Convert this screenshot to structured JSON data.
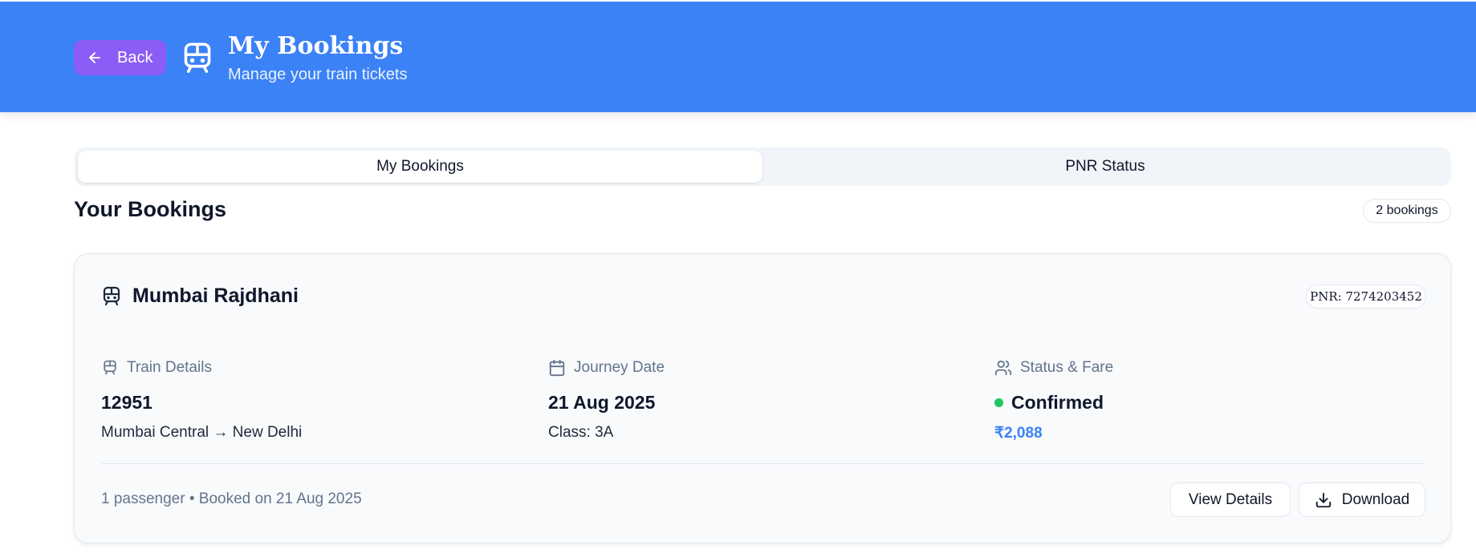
{
  "header": {
    "back_label": "Back",
    "title": "My Bookings",
    "subtitle": "Manage your train tickets",
    "color": "#3b82f6",
    "back_color": "#8b5cf6",
    "icons": {
      "back": "arrow-left-icon",
      "logo": "train-icon"
    }
  },
  "tabs": [
    {
      "label": "My Bookings",
      "active": true
    },
    {
      "label": "PNR Status",
      "active": false
    }
  ],
  "section": {
    "title": "Your Bookings",
    "count_label": "2 bookings"
  },
  "booking": {
    "train_name": "Mumbai Rajdhani",
    "pnr": "PNR: 7274203452",
    "train_details": {
      "label": "Train Details",
      "number": "12951",
      "route": "Mumbai Central → New Delhi"
    },
    "journey": {
      "label": "Journey Date",
      "date": "21 Aug 2025",
      "class": "Class: 3A"
    },
    "status": {
      "label": "Status & Fare",
      "value": "Confirmed",
      "fare": "₹2,088",
      "status_color": "#22c55e"
    },
    "footer_text": "1 passenger • Booked on 21 Aug 2025",
    "view_label": "View Details",
    "download_label": "Download"
  }
}
